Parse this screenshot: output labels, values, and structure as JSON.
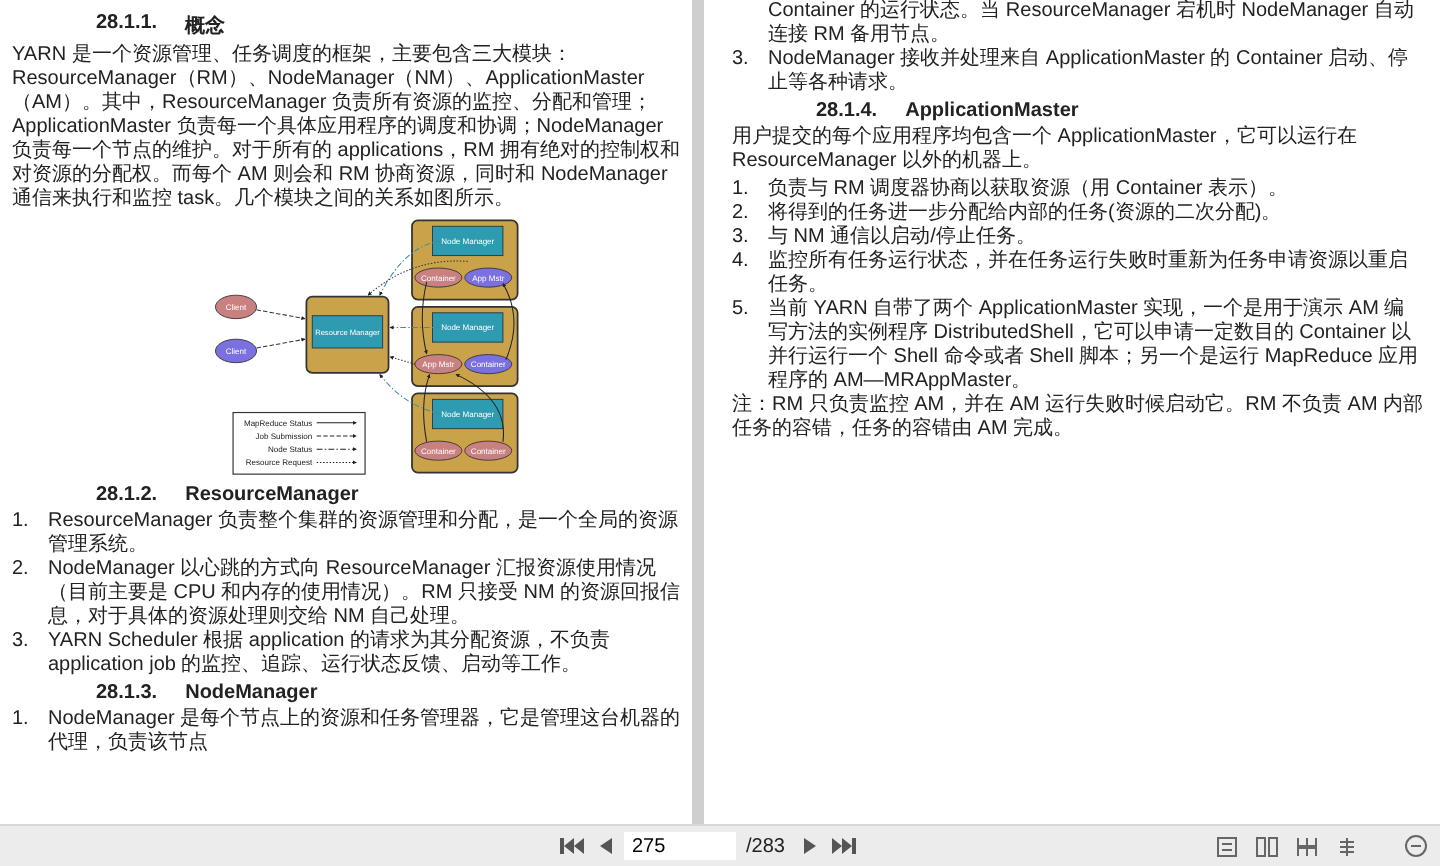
{
  "left_page": {
    "blocks": [
      {
        "kind": "heading",
        "number": "28.1.1.",
        "title": "概念"
      },
      {
        "kind": "paragraph",
        "text": "YARN 是一个资源管理、任务调度的框架，主要包含三大模块：ResourceManager（RM）、NodeManager（NM）、ApplicationMaster（AM）。其中，ResourceManager 负责所有资源的监控、分配和管理；ApplicationMaster 负责每一个具体应用程序的调度和协调；NodeManager 负责每一个节点的维护。对于所有的 applications，RM 拥有绝对的控制权和对资源的分配权。而每个 AM 则会和 RM 协商资源，同时和 NodeManager 通信来执行和监控 task。几个模块之间的关系如图所示。"
      },
      {
        "kind": "figure"
      },
      {
        "kind": "heading",
        "number": "28.1.2.",
        "title": "ResourceManager"
      },
      {
        "kind": "item",
        "number": "1.",
        "text": "ResourceManager 负责整个集群的资源管理和分配，是一个全局的资源管理系统。"
      },
      {
        "kind": "item",
        "number": "2.",
        "text": "NodeManager 以心跳的方式向 ResourceManager 汇报资源使用情况（目前主要是 CPU 和内存的使用情况）。RM 只接受 NM 的资源回报信息，对于具体的资源处理则交给 NM 自己处理。"
      },
      {
        "kind": "item",
        "number": "3.",
        "text": "YARN Scheduler 根据 application 的请求为其分配资源，不负责 application job 的监控、追踪、运行状态反馈、启动等工作。"
      },
      {
        "kind": "heading",
        "number": "28.1.3.",
        "title": "NodeManager"
      },
      {
        "kind": "item",
        "number": "1.",
        "text": "NodeManager 是每个节点上的资源和任务管理器，它是管理这台机器的代理，负责该节点"
      }
    ]
  },
  "diagram": {
    "clients": [
      {
        "label": "Client",
        "color": "#c98080"
      },
      {
        "label": "Client",
        "color": "#7a70e0"
      }
    ],
    "resource_manager": "Resource Manager",
    "nodes": [
      {
        "label": "Node Manager",
        "items": [
          {
            "label": "Container",
            "color": "#c98080"
          },
          {
            "label": "App Mstr",
            "color": "#7a70e0"
          }
        ]
      },
      {
        "label": "Node Manager",
        "items": [
          {
            "label": "App Mstr",
            "color": "#c98080"
          },
          {
            "label": "Container",
            "color": "#7a70e0"
          }
        ]
      },
      {
        "label": "Node Manager",
        "items": [
          {
            "label": "Container",
            "color": "#c98080"
          },
          {
            "label": "Container",
            "color": "#c98080"
          }
        ]
      }
    ],
    "legend": [
      {
        "label": "MapReduce Status",
        "kind": "solid"
      },
      {
        "label": "Job Submission",
        "kind": "dashed"
      },
      {
        "label": "Node Status",
        "kind": "dashdot"
      },
      {
        "label": "Resource Request",
        "kind": "dotted"
      }
    ]
  },
  "right_page": {
    "blocks": [
      {
        "kind": "continuation",
        "text": "Container 的运行状态。当 ResourceManager 宕机时 NodeManager 自动连接 RM 备用节点。"
      },
      {
        "kind": "item",
        "number": "3.",
        "text": "NodeManager 接收并处理来自 ApplicationMaster 的 Container 启动、停止等各种请求。"
      },
      {
        "kind": "heading",
        "number": "28.1.4.",
        "title": "ApplicationMaster"
      },
      {
        "kind": "paragraph",
        "text": "用户提交的每个应用程序均包含一个 ApplicationMaster，它可以运行在 ResourceManager 以外的机器上。"
      },
      {
        "kind": "item",
        "number": "1.",
        "text": "负责与 RM 调度器协商以获取资源（用 Container 表示）。"
      },
      {
        "kind": "item",
        "number": "2.",
        "text": "将得到的任务进一步分配给内部的任务(资源的二次分配)。"
      },
      {
        "kind": "item",
        "number": "3.",
        "text": "与 NM 通信以启动/停止任务。"
      },
      {
        "kind": "item",
        "number": "4.",
        "text": "监控所有任务运行状态，并在任务运行失败时重新为任务申请资源以重启任务。"
      },
      {
        "kind": "item",
        "number": "5.",
        "text": "当前 YARN 自带了两个 ApplicationMaster 实现，一个是用于演示 AM 编写方法的实例程序 DistributedShell，它可以申请一定数目的 Container 以并行运行一个 Shell 命令或者 Shell 脚本；另一个是运行 MapReduce 应用程序的 AM—MRAppMaster。"
      },
      {
        "kind": "paragraph",
        "text": "注：RM 只负责监控 AM，并在 AM 运行失败时候启动它。RM 不负责 AM 内部任务的容错，任务的容错由 AM 完成。"
      }
    ]
  },
  "toolbar": {
    "page": "275",
    "total": "/283"
  }
}
